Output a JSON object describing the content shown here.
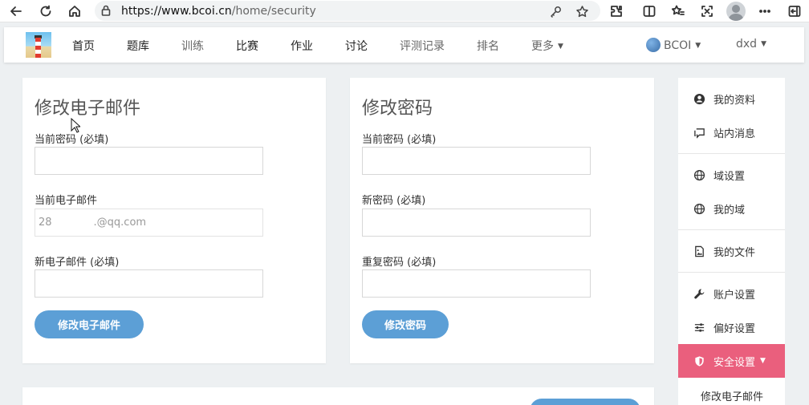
{
  "browser": {
    "url_host": "https://www.bcoi.cn",
    "url_path": "/home/security"
  },
  "nav": {
    "items": [
      {
        "label": "首页"
      },
      {
        "label": "题库"
      },
      {
        "label": "训练"
      },
      {
        "label": "比赛"
      },
      {
        "label": "作业"
      },
      {
        "label": "讨论"
      },
      {
        "label": "评测记录"
      },
      {
        "label": "排名"
      },
      {
        "label": "更多"
      }
    ],
    "domain_label": "BCOI",
    "user_label": "dxd"
  },
  "email_card": {
    "title": "修改电子邮件",
    "current_password_label": "当前密码 (必填)",
    "current_password_value": "",
    "current_email_label": "当前电子邮件",
    "current_email_value": "28        .@qq.com",
    "new_email_label": "新电子邮件 (必填)",
    "new_email_value": "",
    "submit_label": "修改电子邮件"
  },
  "password_card": {
    "title": "修改密码",
    "current_password_label": "当前密码 (必填)",
    "new_password_label": "新密码 (必填)",
    "repeat_password_label": "重复密码 (必填)",
    "submit_label": "修改密码"
  },
  "sidebar": {
    "items": [
      {
        "label": "我的资料",
        "icon": "user-circle-icon"
      },
      {
        "label": "站内消息",
        "icon": "message-icon"
      },
      {
        "label": "域设置",
        "icon": "globe-icon"
      },
      {
        "label": "我的域",
        "icon": "globe-icon"
      },
      {
        "label": "我的文件",
        "icon": "file-image-icon"
      },
      {
        "label": "账户设置",
        "icon": "wrench-icon"
      },
      {
        "label": "偏好设置",
        "icon": "sliders-icon"
      },
      {
        "label": "安全设置",
        "icon": "shield-icon"
      }
    ],
    "sub_items": [
      {
        "label": "修改电子邮件"
      }
    ]
  },
  "colors": {
    "accent": "#5c9fd6",
    "active": "#ea5f7d"
  }
}
